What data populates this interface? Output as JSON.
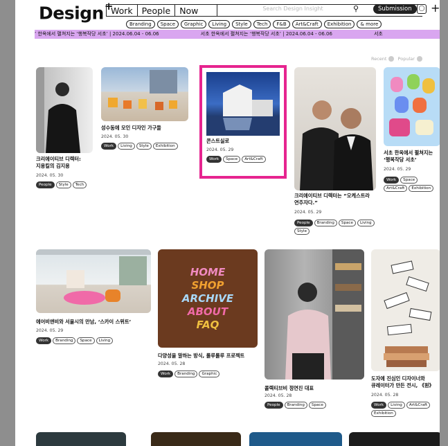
{
  "header": {
    "logo": "Design",
    "logo_mark": "+",
    "nav": [
      "Work",
      "People",
      "Now"
    ],
    "search_placeholder": "Search Design Insight",
    "submit_label": "Submission",
    "categories": [
      "Branding",
      "Space",
      "Graphic",
      "Living",
      "Style",
      "Tech",
      "F&B",
      "Art&Craft",
      "Exhibition",
      "& more"
    ]
  },
  "ticker": [
    "’ 한옥에서 펼쳐지는 ‘행복작당 서초’ | 2024.06.04 - 06.06",
    "서초 한옥에서 펼쳐지는 ‘행복작당 서초’ | 2024.06.04 - 06.06",
    "서초"
  ],
  "sort": {
    "recent": "Recent",
    "popular": "Popular"
  },
  "cards": [
    {
      "title": "크리에이티브 디렉터:\n지용킬의 김지용",
      "date": "2024. 05. 30",
      "tags": [
        "People",
        "Style",
        "Tech"
      ]
    },
    {
      "title": "성수동에 모인 디자인 가구들",
      "date": "2024. 05. 30",
      "tags": [
        "Work",
        "Living",
        "Style",
        "Exhibition"
      ]
    },
    {
      "title": "콘스트실로",
      "date": "2024. 05. 29",
      "tags": [
        "Work",
        "Space",
        "Art&Craft"
      ]
    },
    {
      "title": "크리에이티브 디렉터는 “오케스트라\n연주자다.”",
      "date": "2024. 05. 29",
      "tags": [
        "People",
        "Branding",
        "Space",
        "Living",
        "Style"
      ]
    },
    {
      "title": "서초 한옥에서 펼쳐지는\n‘행복작당 서초’",
      "date": "2024. 05. 29",
      "tags": [
        "Work",
        "Space",
        "Art&Craft",
        "Exhibition"
      ]
    },
    {
      "title": "에어비앤비와 서울시의 만남, ‘스카이 스위트’",
      "date": "2024. 05. 29",
      "tags": [
        "Work",
        "Branding",
        "Space",
        "Living"
      ]
    },
    {
      "title": "다양성을 말하는 방식, 룰루룰루 프로젝트",
      "date": "2024. 05. 28",
      "tags": [
        "Work",
        "Branding",
        "Graphic"
      ]
    },
    {
      "title": "콜렉티브비 정연진 대표",
      "date": "2024. 05. 28",
      "tags": [
        "People",
        "Branding",
        "Space"
      ]
    },
    {
      "title": "도자에 진심인 디자이너와\n큐레이터가 만든 전시, 《원》",
      "date": "2024. 05. 28",
      "tags": [
        "Work",
        "Living",
        "Art&Craft",
        "Exhibition"
      ]
    }
  ],
  "poster_words": [
    "HOME",
    "SHOP",
    "ARCHIVE",
    "ABOUT",
    "FAQ"
  ],
  "colors": {
    "ticker": "#d9a6f0",
    "highlight": "#e6248f",
    "poster_bg": "#6b3a1f"
  }
}
